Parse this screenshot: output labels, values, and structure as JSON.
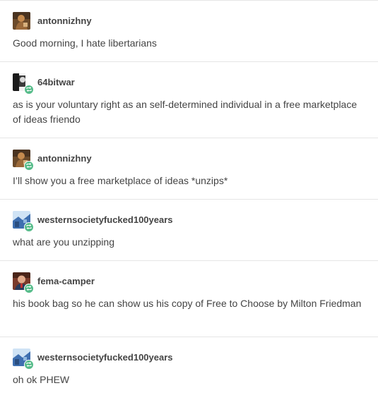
{
  "posts": [
    {
      "username": "antonnizhny",
      "text": "Good morning, I hate libertarians",
      "avatar": "brown-figure-avatar",
      "reblog": false
    },
    {
      "username": "64bitwar",
      "text": "as is your voluntary right as an self-determined individual in a free marketplace of ideas friendo",
      "avatar": "bw-portrait-avatar",
      "reblog": true
    },
    {
      "username": "antonnizhny",
      "text": "I’ll show you a free marketplace of ideas *unzips*",
      "avatar": "brown-figure-avatar",
      "reblog": true
    },
    {
      "username": "westernsocietyfucked100years",
      "text": "what are you unzipping",
      "avatar": "blue-scene-avatar",
      "reblog": true
    },
    {
      "username": "fema-camper",
      "text": "his book bag so he can show us his copy of Free to Choose by Milton Friedman",
      "avatar": "man-portrait-avatar",
      "reblog": true
    },
    {
      "username": "westernsocietyfucked100years",
      "text": "oh ok PHEW",
      "avatar": "blue-scene-avatar",
      "reblog": true
    }
  ],
  "colors": {
    "text": "#444444",
    "divider": "#e5e5e5",
    "reblog_badge": "#56bc8a"
  }
}
